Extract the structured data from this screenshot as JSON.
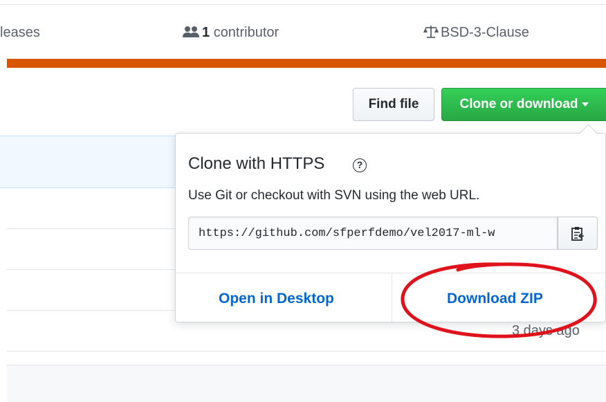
{
  "stats": {
    "releases_label": "leases",
    "contributors_count": "1",
    "contributors_label": "contributor",
    "license_label": "BSD-3-Clause"
  },
  "buttons": {
    "find_file": "Find file",
    "clone_or_download": "Clone or download"
  },
  "file_list": {
    "timestamp": "3 days ago"
  },
  "clone_dropdown": {
    "title": "Clone with HTTPS",
    "help_symbol": "?",
    "description": "Use Git or checkout with SVN using the web URL.",
    "url_value": "https://github.com/sfperfdemo/vel2017-ml-w",
    "open_in_desktop": "Open in Desktop",
    "download_zip": "Download ZIP"
  },
  "colors": {
    "orange_bar": "#d95600",
    "green_button": "#28a745",
    "link_blue": "#0366d6",
    "annotation_red": "#e0121b"
  },
  "icons": [
    "people-icon",
    "law-icon",
    "help-icon",
    "clipboard-icon",
    "caret-down-icon"
  ]
}
